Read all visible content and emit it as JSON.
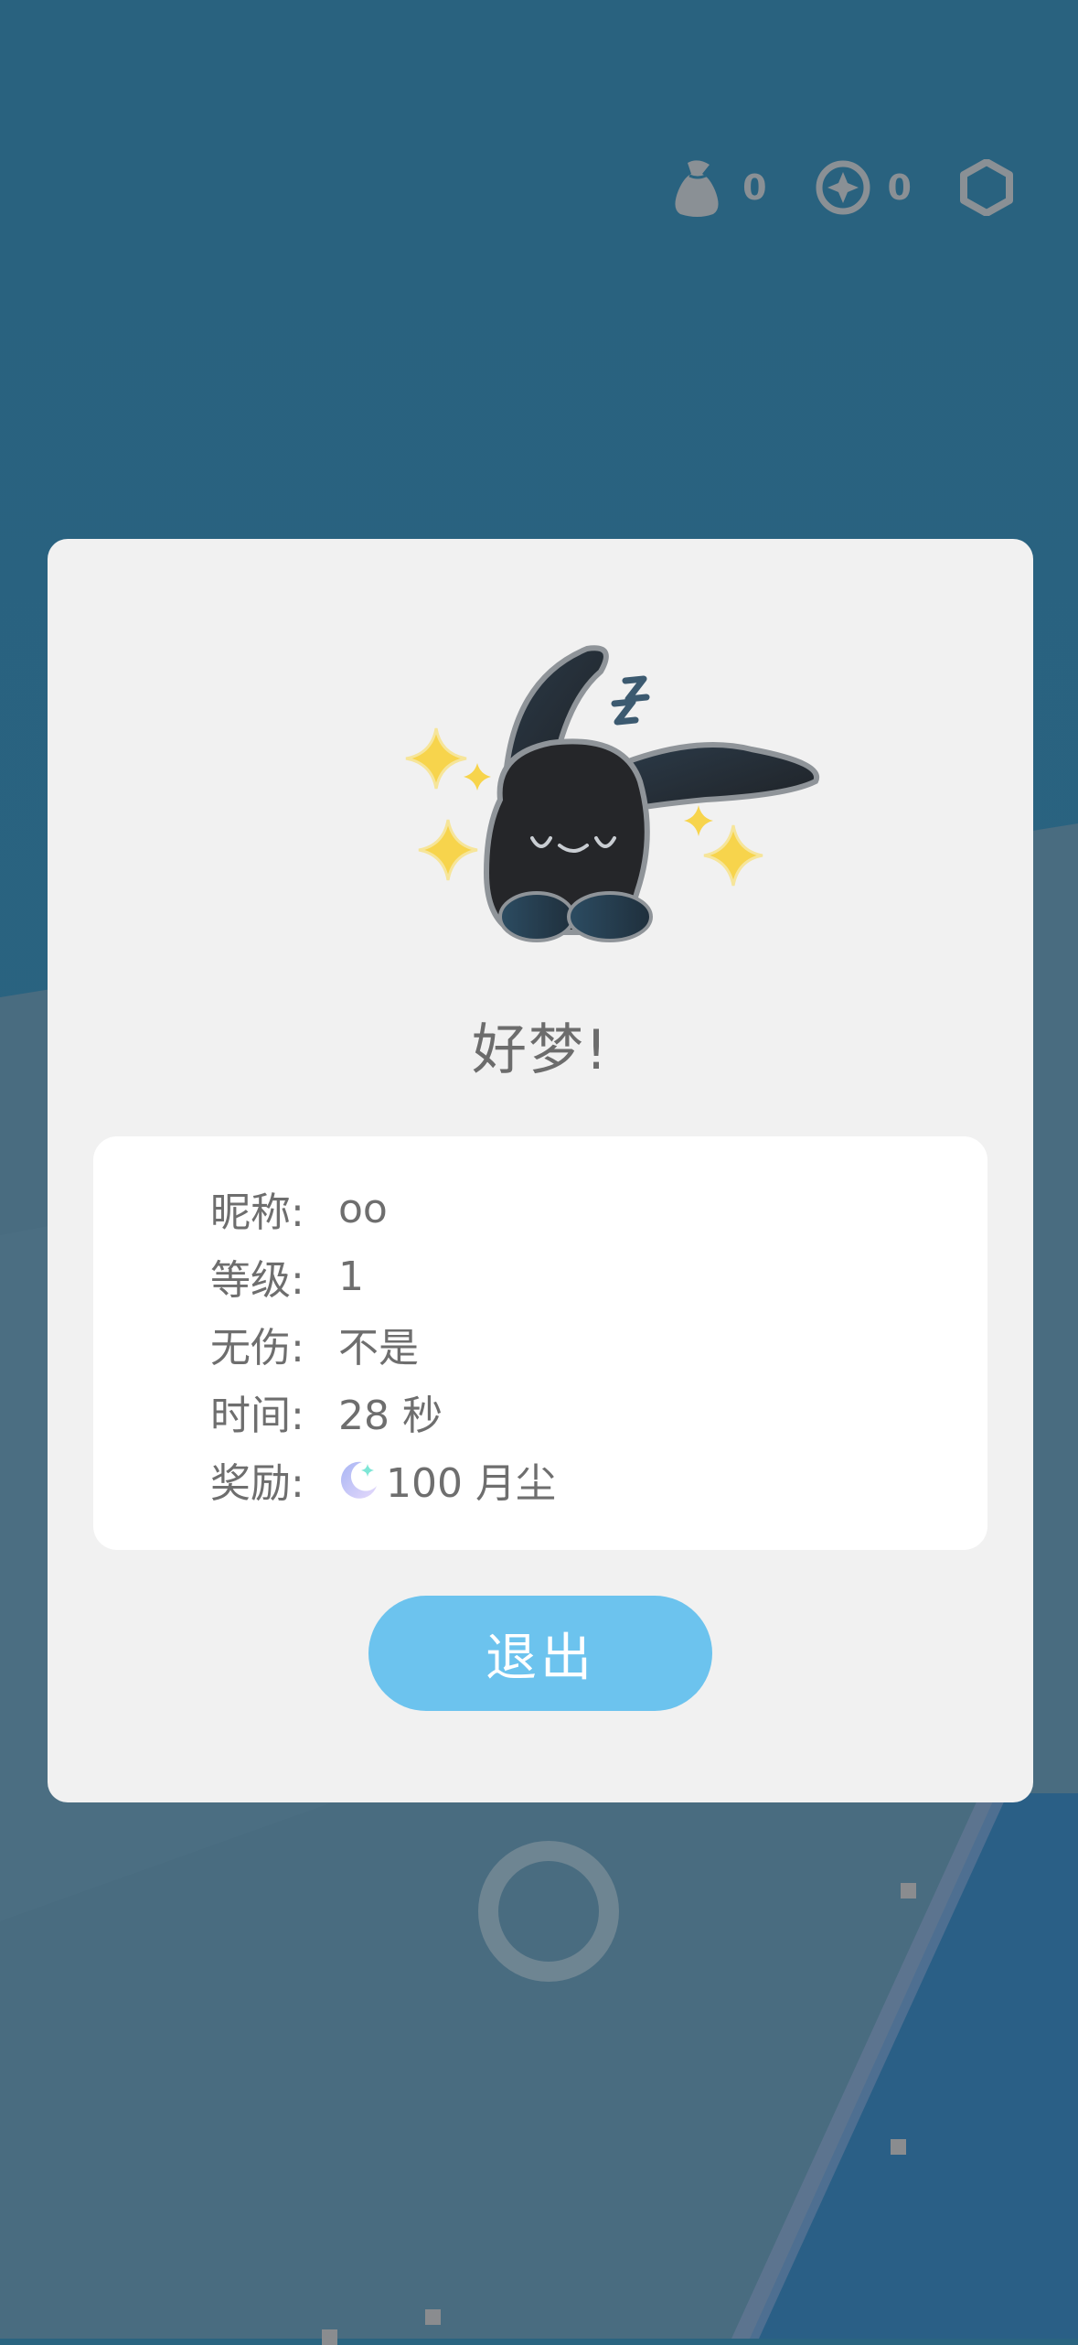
{
  "hud": {
    "bag_count": "0",
    "coin_count": "0",
    "icons": [
      "money-bag-icon",
      "compass-coin-icon",
      "hexagon-settings-icon"
    ]
  },
  "dialog": {
    "title": "好梦!",
    "mascot_icon": "sleeping-rabbit-icon",
    "rows": [
      {
        "label": "昵称:",
        "value": "oo"
      },
      {
        "label": "等级:",
        "value": "1"
      },
      {
        "label": "无伤:",
        "value": "不是"
      },
      {
        "label": "时间:",
        "value": "28 秒"
      },
      {
        "label": "奖励:",
        "value": "100 月尘",
        "icon": "moon-dust-icon"
      }
    ],
    "exit_label": "退出"
  },
  "colors": {
    "background": "#2a6480",
    "dialog": "#f1f1f1",
    "button": "#6cc3ee",
    "text": "#6e6e6e"
  }
}
